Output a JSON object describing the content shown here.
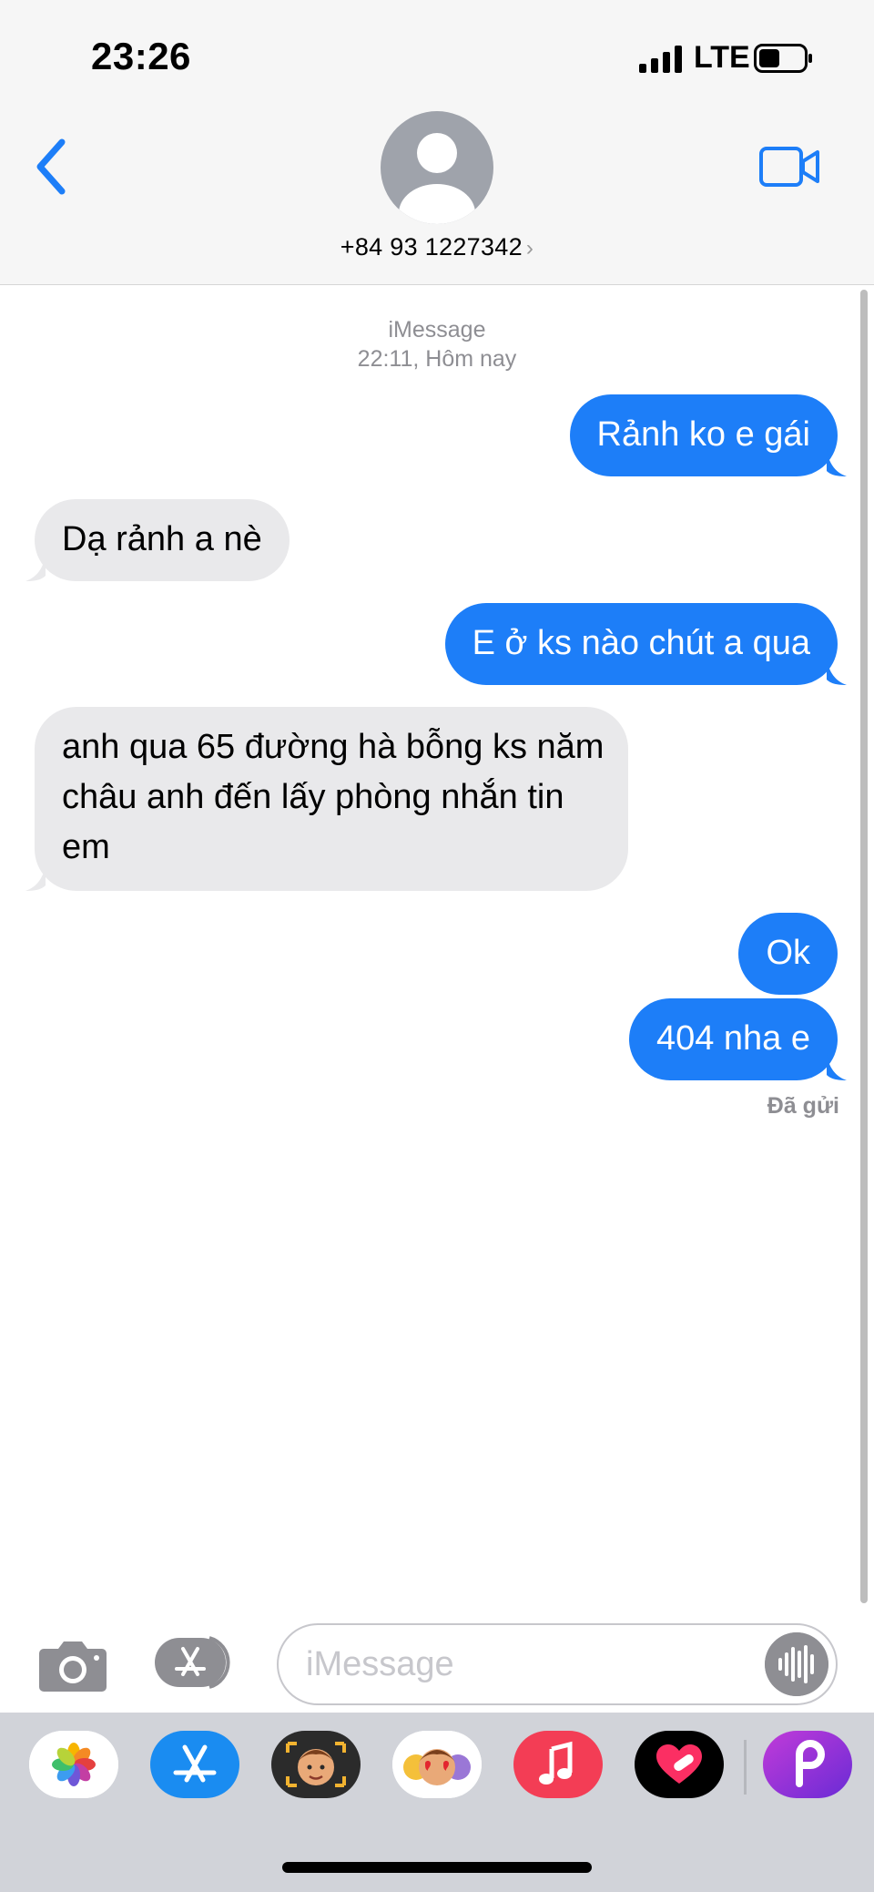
{
  "status_bar": {
    "time": "23:26",
    "network": "LTE"
  },
  "header": {
    "contact": "+84 93 1227342"
  },
  "transcript": {
    "service": "iMessage",
    "timestamp": "22:11, Hôm nay",
    "delivered": "Đã gửi"
  },
  "messages": [
    {
      "direction": "outgoing",
      "text": "Rảnh ko e gái"
    },
    {
      "direction": "incoming",
      "text": "Dạ rảnh a nè"
    },
    {
      "direction": "outgoing",
      "text": "E ở ks nào chút a qua"
    },
    {
      "direction": "incoming",
      "text": "anh qua 65 đường  hà bỗng  ks năm châu anh đến lấy phòng nhắn tin em"
    },
    {
      "direction": "outgoing",
      "text": "Ok"
    },
    {
      "direction": "outgoing",
      "text": "404 nha e"
    }
  ],
  "composer": {
    "placeholder": "iMessage"
  },
  "app_drawer": [
    "photos-icon",
    "app-store-icon",
    "memoji-icon",
    "memoji-stickers-icon",
    "music-icon",
    "heart-app-icon",
    "picsart-icon"
  ],
  "colors": {
    "accent": "#1d7ef8",
    "incoming_bubble": "#e9e9eb",
    "outgoing_bubble": "#1d7ef8"
  }
}
